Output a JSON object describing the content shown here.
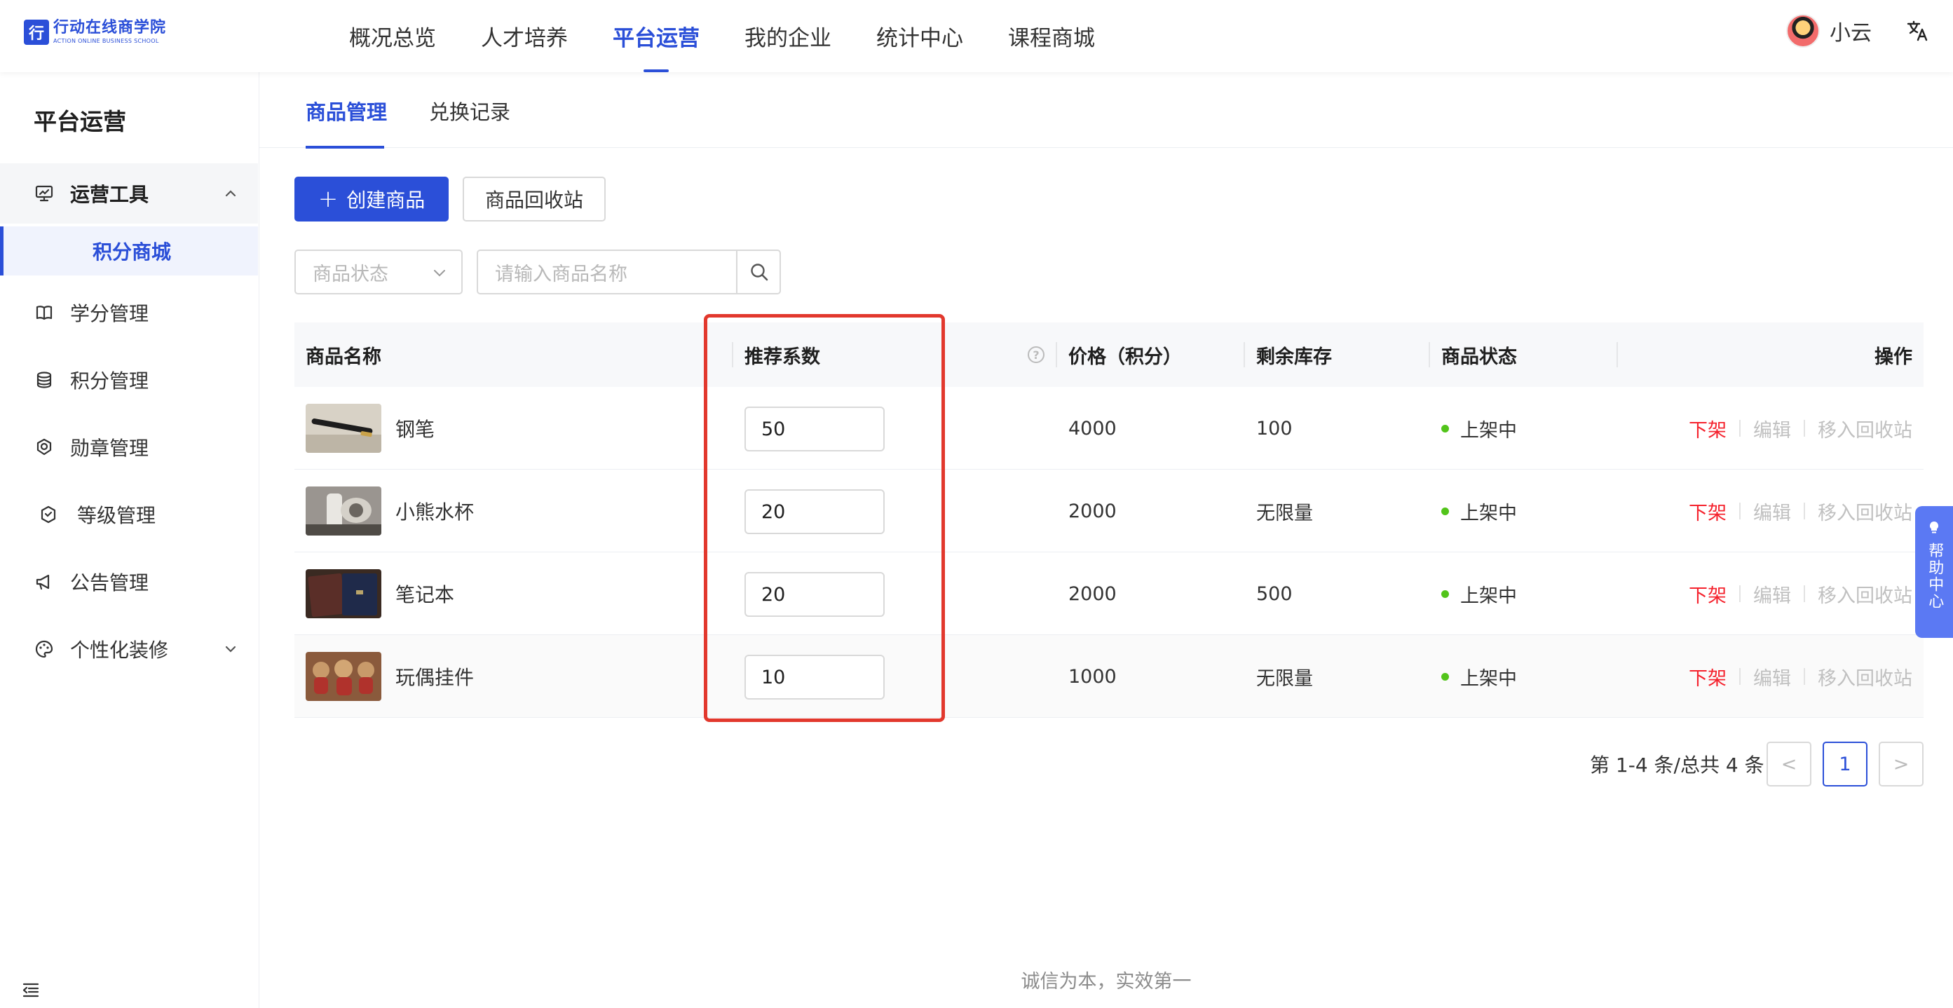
{
  "logo": {
    "mark": "行",
    "name_cn": "行动在线商学院",
    "name_en": "ACTION ONLINE BUSINESS SCHOOL"
  },
  "nav": {
    "items": [
      {
        "label": "概况总览"
      },
      {
        "label": "人才培养"
      },
      {
        "label": "平台运营",
        "active": true
      },
      {
        "label": "我的企业"
      },
      {
        "label": "统计中心"
      },
      {
        "label": "课程商城"
      }
    ]
  },
  "user": {
    "name": "小云",
    "lang_icon": "translate-icon"
  },
  "sidebar": {
    "title": "平台运营",
    "group": {
      "label": "运营工具",
      "icon": "dashboard-icon",
      "expanded": true
    },
    "active_sub": {
      "label": "积分商城"
    },
    "items": [
      {
        "label": "学分管理",
        "icon": "book-icon"
      },
      {
        "label": "积分管理",
        "icon": "coins-icon"
      },
      {
        "label": "勋章管理",
        "icon": "medal-icon"
      },
      {
        "label": "等级管理",
        "icon": "level-icon"
      },
      {
        "label": "公告管理",
        "icon": "megaphone-icon"
      },
      {
        "label": "个性化装修",
        "icon": "palette-icon"
      }
    ]
  },
  "tabs": [
    {
      "label": "商品管理",
      "active": true
    },
    {
      "label": "兑换记录"
    }
  ],
  "toolbar": {
    "create_label": "创建商品",
    "recycle_label": "商品回收站"
  },
  "filters": {
    "status_placeholder": "商品状态",
    "search_placeholder": "请输入商品名称"
  },
  "table": {
    "headers": {
      "name": "商品名称",
      "coef": "推荐系数",
      "price": "价格（积分）",
      "stock": "剩余库存",
      "status": "商品状态",
      "ops": "操作"
    },
    "rows": [
      {
        "name": "钢笔",
        "coef": "50",
        "price": "4000",
        "stock": "100",
        "status": "上架中",
        "thumb": "pen-image"
      },
      {
        "name": "小熊水杯",
        "coef": "20",
        "price": "2000",
        "stock": "无限量",
        "status": "上架中",
        "thumb": "cup-image"
      },
      {
        "name": "笔记本",
        "coef": "20",
        "price": "2000",
        "stock": "500",
        "status": "上架中",
        "thumb": "notebook-image"
      },
      {
        "name": "玩偶挂件",
        "coef": "10",
        "price": "1000",
        "stock": "无限量",
        "status": "上架中",
        "thumb": "bears-image"
      }
    ],
    "ops": {
      "off": "下架",
      "edit": "编辑",
      "recycle": "移入回收站"
    }
  },
  "pagination": {
    "summary": "第 1-4 条/总共 4 条",
    "current": "1",
    "prev": "<",
    "next": ">"
  },
  "help": {
    "label": "帮助中心"
  },
  "footer": {
    "slogan": "诚信为本，实效第一"
  },
  "colors": {
    "primary": "#2b4fd8",
    "danger": "#f5222d",
    "success": "#52c41a",
    "highlight": "#e2382d"
  }
}
